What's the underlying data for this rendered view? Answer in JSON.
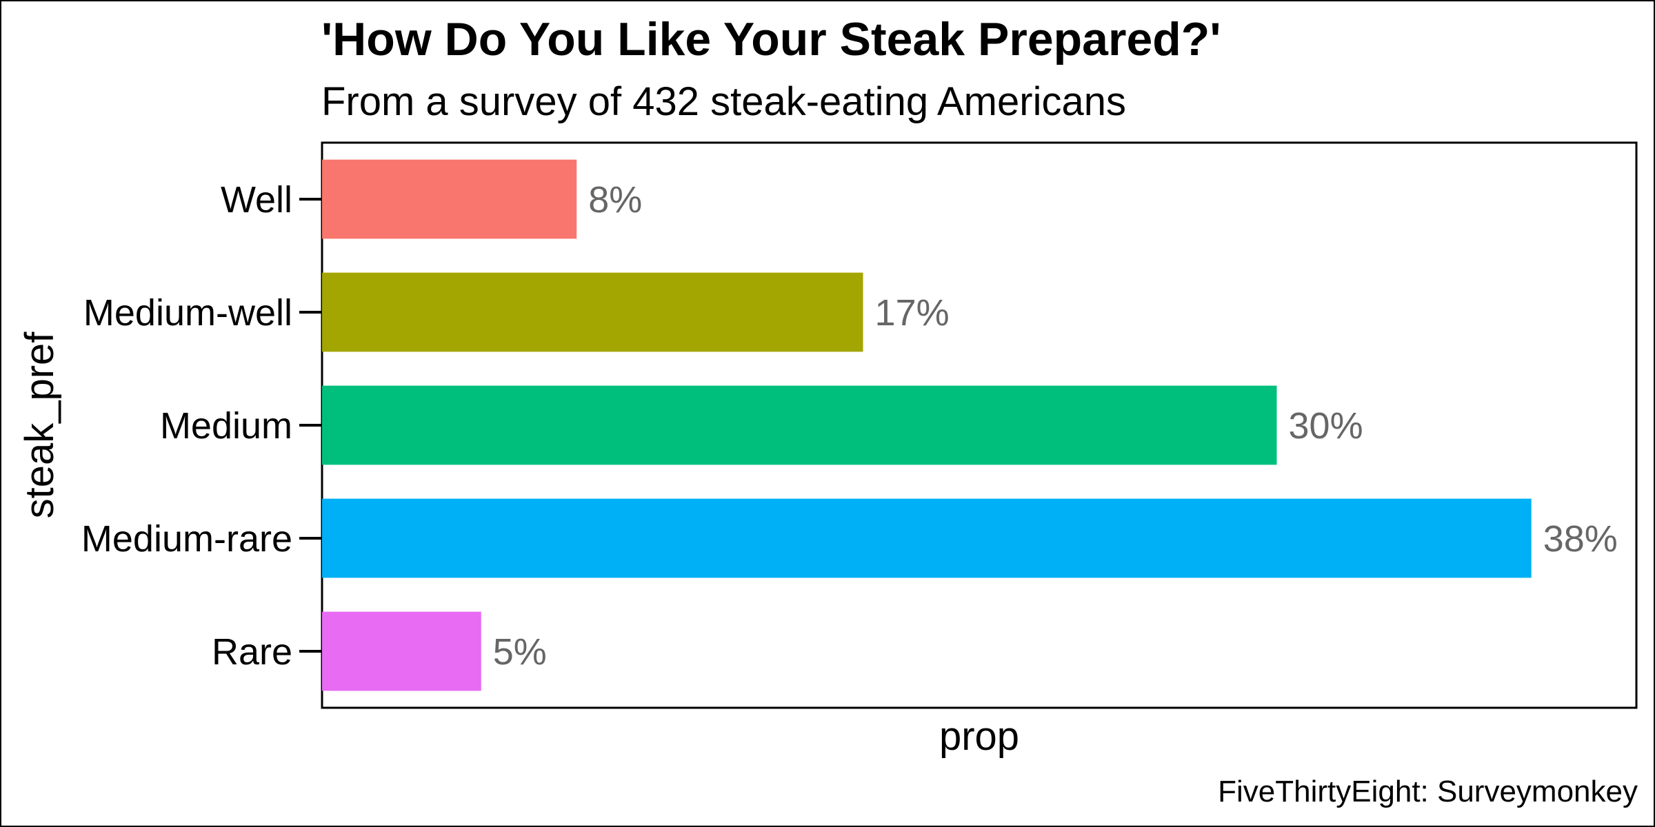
{
  "chart_data": {
    "type": "bar",
    "orientation": "horizontal",
    "title": "'How Do You Like Your Steak Prepared?'",
    "subtitle": "From a survey of 432 steak-eating Americans",
    "xlabel": "prop",
    "ylabel": "steak_pref",
    "caption": "FiveThirtyEight: Surveymonkey",
    "categories": [
      "Well",
      "Medium-well",
      "Medium",
      "Medium-rare",
      "Rare"
    ],
    "values": [
      0.08,
      0.17,
      0.3,
      0.38,
      0.05
    ],
    "labels": [
      "8%",
      "17%",
      "30%",
      "38%",
      "5%"
    ],
    "colors": [
      "#F8766D",
      "#A3A500",
      "#00BF7D",
      "#00B0F6",
      "#E76BF3"
    ],
    "label_color": "#666666",
    "xlim": [
      0,
      0.413
    ],
    "x_ticks_shown": false,
    "grid": false,
    "legend": "none"
  }
}
